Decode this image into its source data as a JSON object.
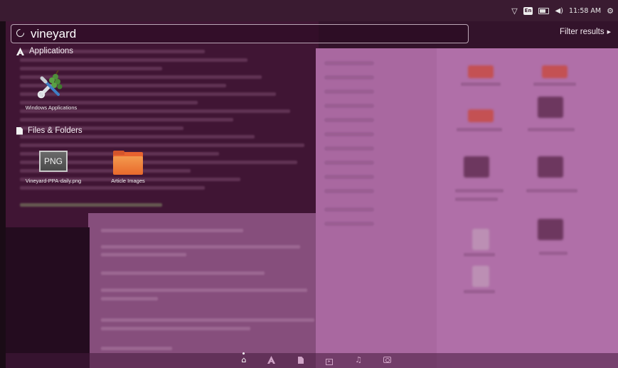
{
  "top_panel": {
    "keyboard_layout": "En",
    "clock": "11:58 AM",
    "icons": [
      "wifi-icon",
      "keyboard-icon",
      "battery-icon",
      "volume-icon",
      "gear-icon"
    ]
  },
  "search": {
    "query": "vineyard",
    "filter_label": "Filter results"
  },
  "categories": {
    "applications": {
      "label": "Applications",
      "results": [
        {
          "label": "Windows Applications",
          "icon": "wine-tools-icon"
        }
      ]
    },
    "files_folders": {
      "label": "Files & Folders",
      "results": [
        {
          "label": "Vineyard-PPA-daily.png",
          "icon": "png-file-icon",
          "badge": "PNG"
        },
        {
          "label": "Article Images",
          "icon": "folder-icon"
        }
      ]
    }
  },
  "lenses": [
    {
      "name": "home",
      "icon": "home-icon",
      "active": true
    },
    {
      "name": "applications",
      "icon": "applications-icon",
      "active": false
    },
    {
      "name": "files",
      "icon": "files-icon",
      "active": false
    },
    {
      "name": "video",
      "icon": "video-icon",
      "active": false
    },
    {
      "name": "music",
      "icon": "music-icon",
      "active": false
    },
    {
      "name": "photos",
      "icon": "photos-icon",
      "active": false
    }
  ],
  "colors": {
    "panel": "#3a1b31",
    "dash_tint": "#7a2864",
    "folder_orange": "#e8622f"
  }
}
